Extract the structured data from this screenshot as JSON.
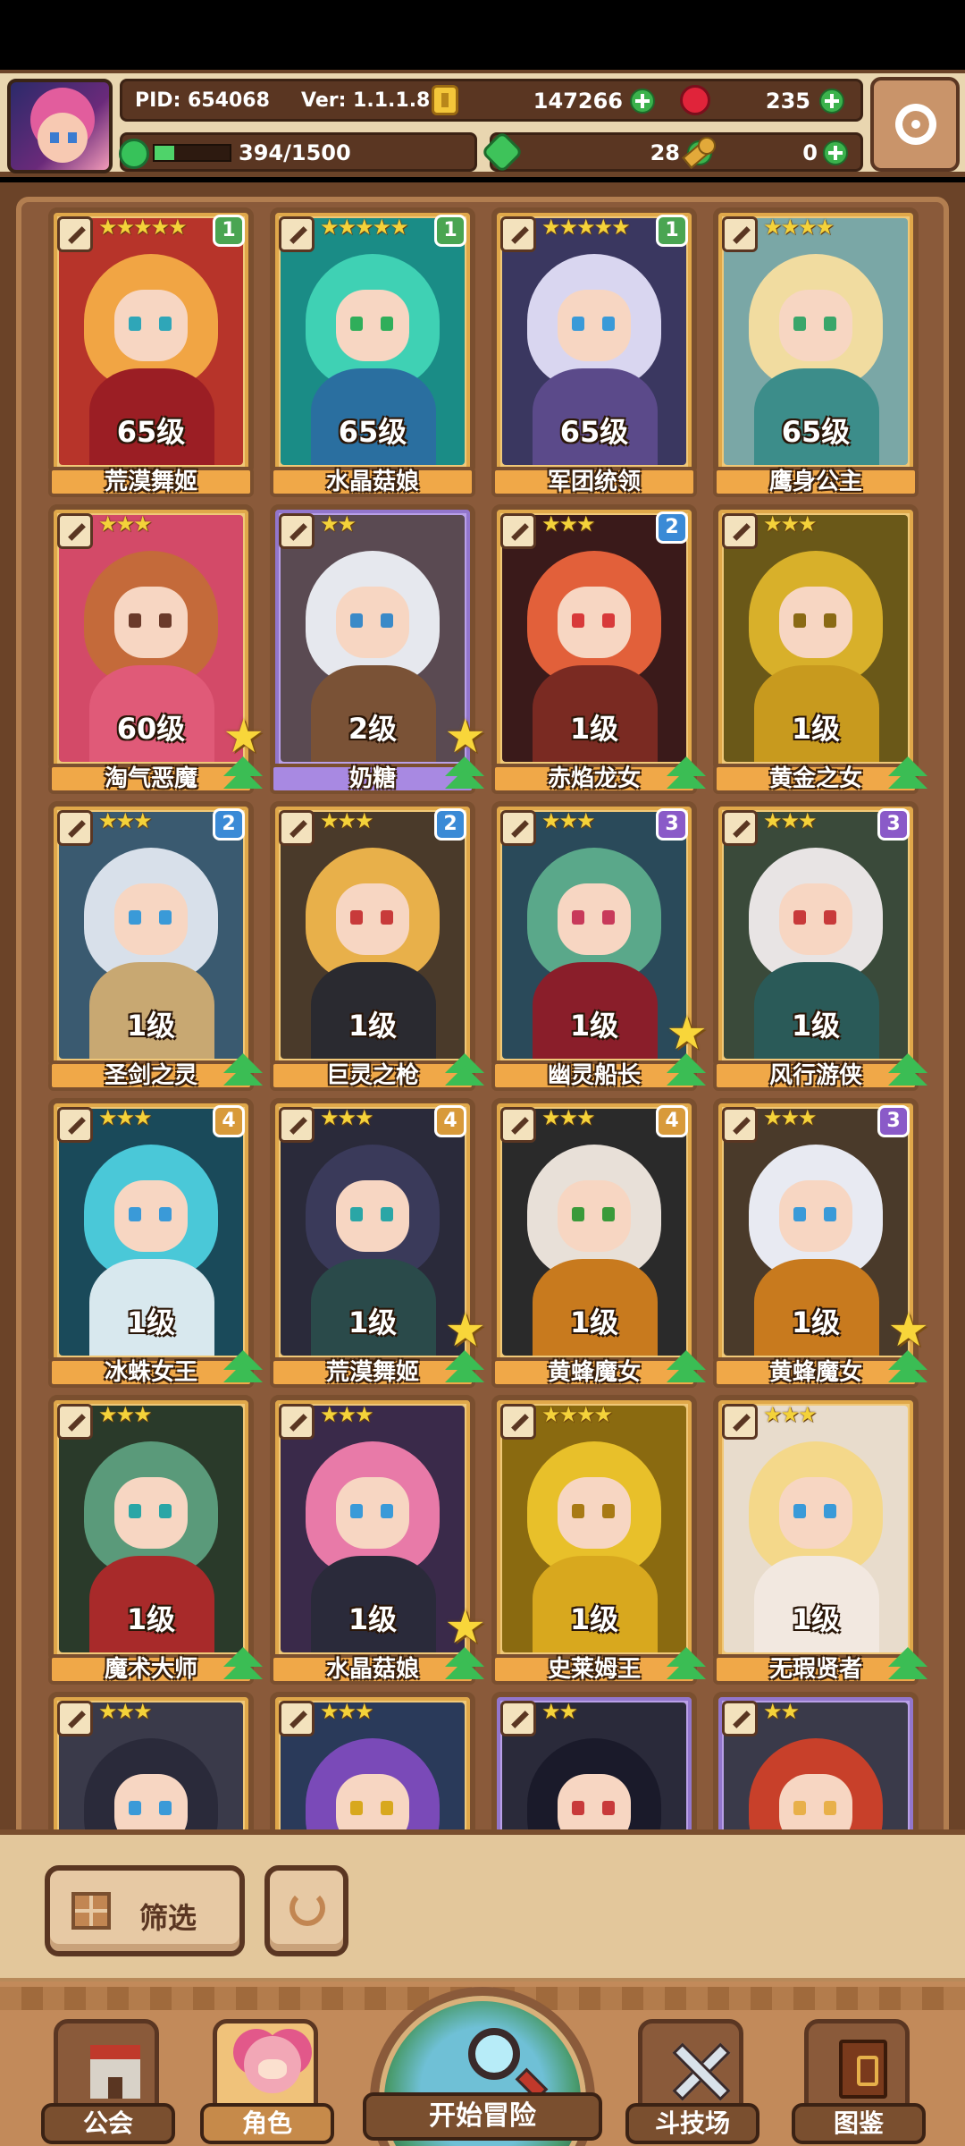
{
  "hud": {
    "pid": "PID: 654068",
    "version": "Ver: 1.1.1.8",
    "gold": "147266",
    "gems": "235",
    "xp_text": "394/1500",
    "xp_fraction": 0.263,
    "clover": "28",
    "keys": "0"
  },
  "cards": [
    {
      "name": "荒漠舞姬",
      "level": "65级",
      "stars": "★★★★★",
      "rank": "1",
      "rank_color": "#4aa552",
      "gold_star": false,
      "up": false,
      "purple": false,
      "palette": {
        "bg": "#b7342a",
        "hair": "#f1a544",
        "body": "#9b1e24",
        "eye": "#2fa6b8"
      }
    },
    {
      "name": "水晶菇娘",
      "level": "65级",
      "stars": "★★★★★",
      "rank": "1",
      "rank_color": "#4aa552",
      "gold_star": false,
      "up": false,
      "purple": false,
      "palette": {
        "bg": "#1a8c86",
        "hair": "#3fd1b4",
        "body": "#2a6fa0",
        "eye": "#2fae5a"
      }
    },
    {
      "name": "军团统领",
      "level": "65级",
      "stars": "★★★★★",
      "rank": "1",
      "rank_color": "#4aa552",
      "gold_star": false,
      "up": false,
      "purple": false,
      "palette": {
        "bg": "#3a3760",
        "hair": "#d9d6f0",
        "body": "#5b4a8a",
        "eye": "#3a9ad8"
      }
    },
    {
      "name": "鹰身公主",
      "level": "65级",
      "stars": "★★★★",
      "rank": "",
      "rank_color": "",
      "gold_star": false,
      "up": false,
      "purple": false,
      "palette": {
        "bg": "#7aa7a6",
        "hair": "#f1dca0",
        "body": "#3c8d8a",
        "eye": "#3aa66a"
      }
    },
    {
      "name": "淘气恶魔",
      "level": "60级",
      "stars": "★★★",
      "rank": "",
      "rank_color": "",
      "gold_star": true,
      "up": true,
      "purple": false,
      "palette": {
        "bg": "#d34a68",
        "hair": "#c46a3a",
        "body": "#e05a78",
        "eye": "#6a3a2a"
      }
    },
    {
      "name": "奶糖",
      "level": "2级",
      "stars": "★★",
      "rank": "",
      "rank_color": "",
      "gold_star": true,
      "up": true,
      "purple": true,
      "palette": {
        "bg": "#5a4a52",
        "hair": "#e6e8ee",
        "body": "#7a5236",
        "eye": "#3a8ac8"
      }
    },
    {
      "name": "赤焰龙女",
      "level": "1级",
      "stars": "★★★",
      "rank": "2",
      "rank_color": "#3a8ad6",
      "gold_star": false,
      "up": true,
      "purple": false,
      "palette": {
        "bg": "#3a1a1a",
        "hair": "#e2603a",
        "body": "#7a2a22",
        "eye": "#d83a3a"
      }
    },
    {
      "name": "黄金之女",
      "level": "1级",
      "stars": "★★★",
      "rank": "",
      "rank_color": "",
      "gold_star": false,
      "up": true,
      "purple": false,
      "palette": {
        "bg": "#6a5818",
        "hair": "#d8b02a",
        "body": "#c89a1e",
        "eye": "#8a6a14"
      }
    },
    {
      "name": "圣剑之灵",
      "level": "1级",
      "stars": "★★★",
      "rank": "2",
      "rank_color": "#3a8ad6",
      "gold_star": false,
      "up": true,
      "purple": false,
      "palette": {
        "bg": "#3a5a70",
        "hair": "#d8e0ea",
        "body": "#c8a872",
        "eye": "#3a9ad8"
      }
    },
    {
      "name": "巨灵之枪",
      "level": "1级",
      "stars": "★★★",
      "rank": "2",
      "rank_color": "#3a8ad6",
      "gold_star": false,
      "up": true,
      "purple": false,
      "palette": {
        "bg": "#4a3a2a",
        "hair": "#e8b04a",
        "body": "#2a2a30",
        "eye": "#c83a3a"
      }
    },
    {
      "name": "幽灵船长",
      "level": "1级",
      "stars": "★★★",
      "rank": "3",
      "rank_color": "#8a5ac8",
      "gold_star": true,
      "up": true,
      "purple": false,
      "palette": {
        "bg": "#2a4a5a",
        "hair": "#5aa88a",
        "body": "#8a1e2a",
        "eye": "#c83a5a"
      }
    },
    {
      "name": "风行游侠",
      "level": "1级",
      "stars": "★★★",
      "rank": "3",
      "rank_color": "#8a5ac8",
      "gold_star": false,
      "up": true,
      "purple": false,
      "palette": {
        "bg": "#3a4a3a",
        "hair": "#e8e4e4",
        "body": "#2a5a58",
        "eye": "#c83a3a"
      }
    },
    {
      "name": "冰蛛女王",
      "level": "1级",
      "stars": "★★★",
      "rank": "4",
      "rank_color": "#d89a3a",
      "gold_star": false,
      "up": true,
      "purple": false,
      "palette": {
        "bg": "#1a4a5a",
        "hair": "#4ac8d8",
        "body": "#d8e8ee",
        "eye": "#3a9ad8"
      }
    },
    {
      "name": "荒漠舞姬",
      "level": "1级",
      "stars": "★★★",
      "rank": "4",
      "rank_color": "#d89a3a",
      "gold_star": true,
      "up": true,
      "purple": false,
      "palette": {
        "bg": "#2a2a3a",
        "hair": "#3a3a5a",
        "body": "#2a4a4a",
        "eye": "#2aa6a6"
      }
    },
    {
      "name": "黄蜂魔女",
      "level": "1级",
      "stars": "★★★",
      "rank": "4",
      "rank_color": "#d89a3a",
      "gold_star": false,
      "up": true,
      "purple": false,
      "palette": {
        "bg": "#2a2a2a",
        "hair": "#e8e0d8",
        "body": "#c87a1e",
        "eye": "#3a9a3a"
      }
    },
    {
      "name": "黄蜂魔女",
      "level": "1级",
      "stars": "★★★",
      "rank": "3",
      "rank_color": "#8a5ac8",
      "gold_star": true,
      "up": true,
      "purple": false,
      "palette": {
        "bg": "#4a3a2a",
        "hair": "#e8eaf2",
        "body": "#c87a1e",
        "eye": "#3a9ad8"
      }
    },
    {
      "name": "魔术大师",
      "level": "1级",
      "stars": "★★★",
      "rank": "",
      "rank_color": "",
      "gold_star": false,
      "up": true,
      "purple": false,
      "palette": {
        "bg": "#2a3a2a",
        "hair": "#5a9a7a",
        "body": "#a82a2a",
        "eye": "#2aa6a6"
      }
    },
    {
      "name": "水晶菇娘",
      "level": "1级",
      "stars": "★★★",
      "rank": "",
      "rank_color": "",
      "gold_star": true,
      "up": true,
      "purple": false,
      "palette": {
        "bg": "#3a2a4a",
        "hair": "#e87aa8",
        "body": "#2a2a3a",
        "eye": "#3a9ad8"
      }
    },
    {
      "name": "史莱姆王",
      "level": "1级",
      "stars": "★★★★",
      "rank": "",
      "rank_color": "",
      "gold_star": false,
      "up": true,
      "purple": false,
      "palette": {
        "bg": "#8a6a10",
        "hair": "#e8c02a",
        "body": "#d8a81e",
        "eye": "#a87a14"
      }
    },
    {
      "name": "无瑕贤者",
      "level": "1级",
      "stars": "★★★",
      "rank": "",
      "rank_color": "",
      "gold_star": false,
      "up": true,
      "purple": false,
      "palette": {
        "bg": "#e8dccc",
        "hair": "#f4d88a",
        "body": "#f2e8e0",
        "eye": "#3a9ad8"
      }
    },
    {
      "name": "",
      "level": "",
      "stars": "★★★",
      "rank": "",
      "rank_color": "",
      "gold_star": false,
      "up": false,
      "purple": false,
      "palette": {
        "bg": "#3a3a4a",
        "hair": "#2a2a3a",
        "body": "#3a3a4a",
        "eye": "#3a9ad8"
      }
    },
    {
      "name": "",
      "level": "",
      "stars": "★★★",
      "rank": "",
      "rank_color": "",
      "gold_star": false,
      "up": false,
      "purple": false,
      "palette": {
        "bg": "#2a3a5a",
        "hair": "#7a4ab8",
        "body": "#3a5aa8",
        "eye": "#d8a81e"
      }
    },
    {
      "name": "",
      "level": "",
      "stars": "★★",
      "rank": "",
      "rank_color": "",
      "gold_star": false,
      "up": false,
      "purple": true,
      "palette": {
        "bg": "#2a2a3a",
        "hair": "#1a1a2a",
        "body": "#3a7a3a",
        "eye": "#c83a3a"
      }
    },
    {
      "name": "",
      "level": "",
      "stars": "★★",
      "rank": "",
      "rank_color": "",
      "gold_star": false,
      "up": false,
      "purple": true,
      "palette": {
        "bg": "#3a3a4a",
        "hair": "#c8402a",
        "body": "#8a3a2a",
        "eye": "#e8b04a"
      }
    }
  ],
  "controls": {
    "filter_label": "筛选"
  },
  "nav": {
    "guild": "公会",
    "role": "角色",
    "adventure": "开始冒险",
    "arena": "斗技场",
    "codex": "图鉴"
  },
  "icons": [
    "avatar",
    "gold-coin-icon",
    "red-gem-icon",
    "clover-icon",
    "key-icon",
    "plus-icon",
    "settings-gear-icon",
    "filter-grid-icon",
    "reset-icon",
    "guild-icon",
    "role-icon",
    "magnifier-icon",
    "crossed-swords-icon",
    "book-icon"
  ]
}
